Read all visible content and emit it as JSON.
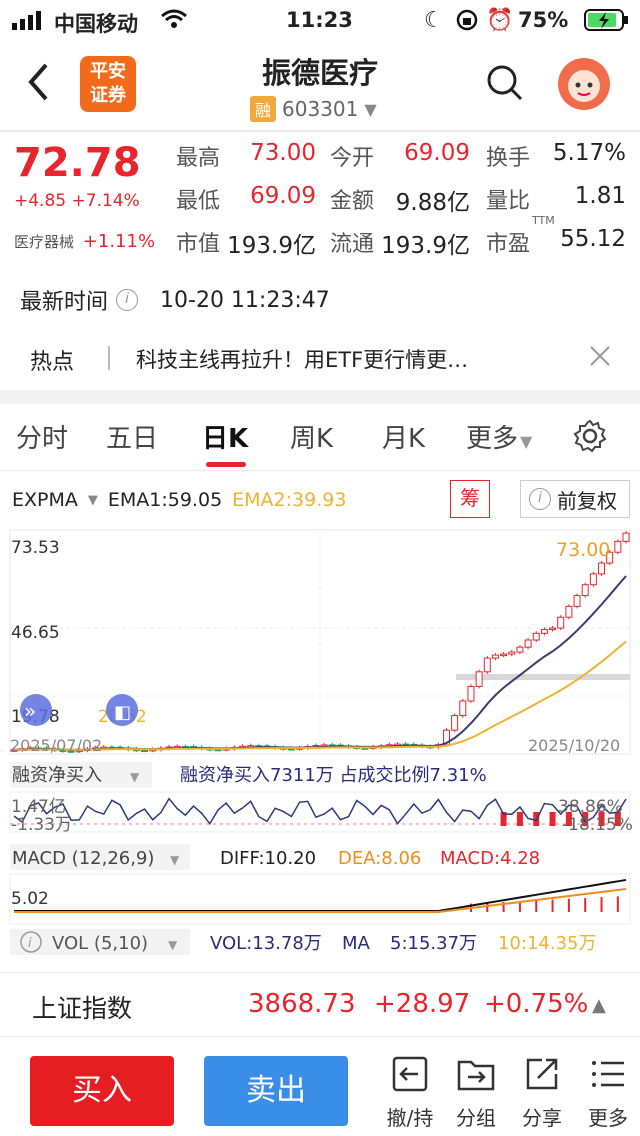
{
  "status_bar": {
    "carrier": "中国移动",
    "time": "11:23",
    "battery": "75%"
  },
  "header": {
    "title": "振德医疗",
    "margin_tag": "融",
    "code": "603301",
    "broker_logo": "平安\n证券"
  },
  "quote": {
    "price": "72.78",
    "change": "+4.85",
    "change_pct": "+7.14%",
    "sector": "医疗器械",
    "sector_pct": "+1.11%",
    "fields": [
      {
        "label": "最高",
        "value": "73.00",
        "color": "#e8242c"
      },
      {
        "label": "今开",
        "value": "69.09",
        "color": "#e8242c"
      },
      {
        "label": "换手",
        "value": "5.17%",
        "color": "#222222"
      },
      {
        "label": "最低",
        "value": "69.09",
        "color": "#e8242c"
      },
      {
        "label": "金额",
        "value": "9.88亿",
        "color": "#222222"
      },
      {
        "label": "量比",
        "value": "1.81",
        "color": "#222222"
      },
      {
        "label": "市值",
        "value": "193.9亿",
        "color": "#222222"
      },
      {
        "label": "流通",
        "value": "193.9亿",
        "color": "#222222"
      },
      {
        "label": "市盈",
        "value": "55.12",
        "color": "#222222"
      }
    ],
    "ttm": "TTM"
  },
  "update": {
    "label": "最新时间",
    "time": "10-20 11:23:47"
  },
  "hot": {
    "label": "热点",
    "text": "科技主线再拉升！用ETF更行情更…"
  },
  "tabs": [
    "分时",
    "五日",
    "日K",
    "周K",
    "月K",
    "更多"
  ],
  "active_tab": 2,
  "indicator": {
    "name": "EXPMA",
    "ema1": "EMA1:59.05",
    "ema2": "EMA2:39.93",
    "chip_btn": "筹",
    "adj_btn": "前复权"
  },
  "chart_data": {
    "type": "candlestick",
    "y_ticks": [
      "73.53",
      "46.65",
      "19.78"
    ],
    "x_start": "2025/07/02",
    "x_end": "2025/10/20",
    "last_label": "73.00",
    "ylim": [
      19.78,
      73.53
    ]
  },
  "margin_panel": {
    "title": "融资净买入",
    "summary": "融资净买入7311万  占成交比例7.31%",
    "y_top": "1.47亿",
    "y_bottom": "-1.33万",
    "right_top": "38.86%",
    "right_bottom": "-18.15%"
  },
  "macd": {
    "title": "MACD (12,26,9)",
    "diff": "DIFF:10.20",
    "dea": "DEA:8.06",
    "macd": "MACD:4.28",
    "y_tick": "5.02"
  },
  "vol": {
    "title": "VOL (5,10)",
    "vol": "VOL:13.78万",
    "ma_label": "MA",
    "ma5": "5:15.37万",
    "ma10": "10:14.35万"
  },
  "index_bar": {
    "name": "上证指数",
    "value": "3868.73",
    "change": "+28.97",
    "pct": "+0.75%"
  },
  "bottom_bar": {
    "buy": "买入",
    "sell": "卖出",
    "items": [
      "撤/持",
      "分组",
      "分享",
      "更多"
    ]
  },
  "colors": {
    "up": "#e8242c",
    "buy_btn": "#e61e21",
    "sell_btn": "#3a8ee8",
    "ema2": "#f0b232",
    "dea": "#f08c1a"
  }
}
